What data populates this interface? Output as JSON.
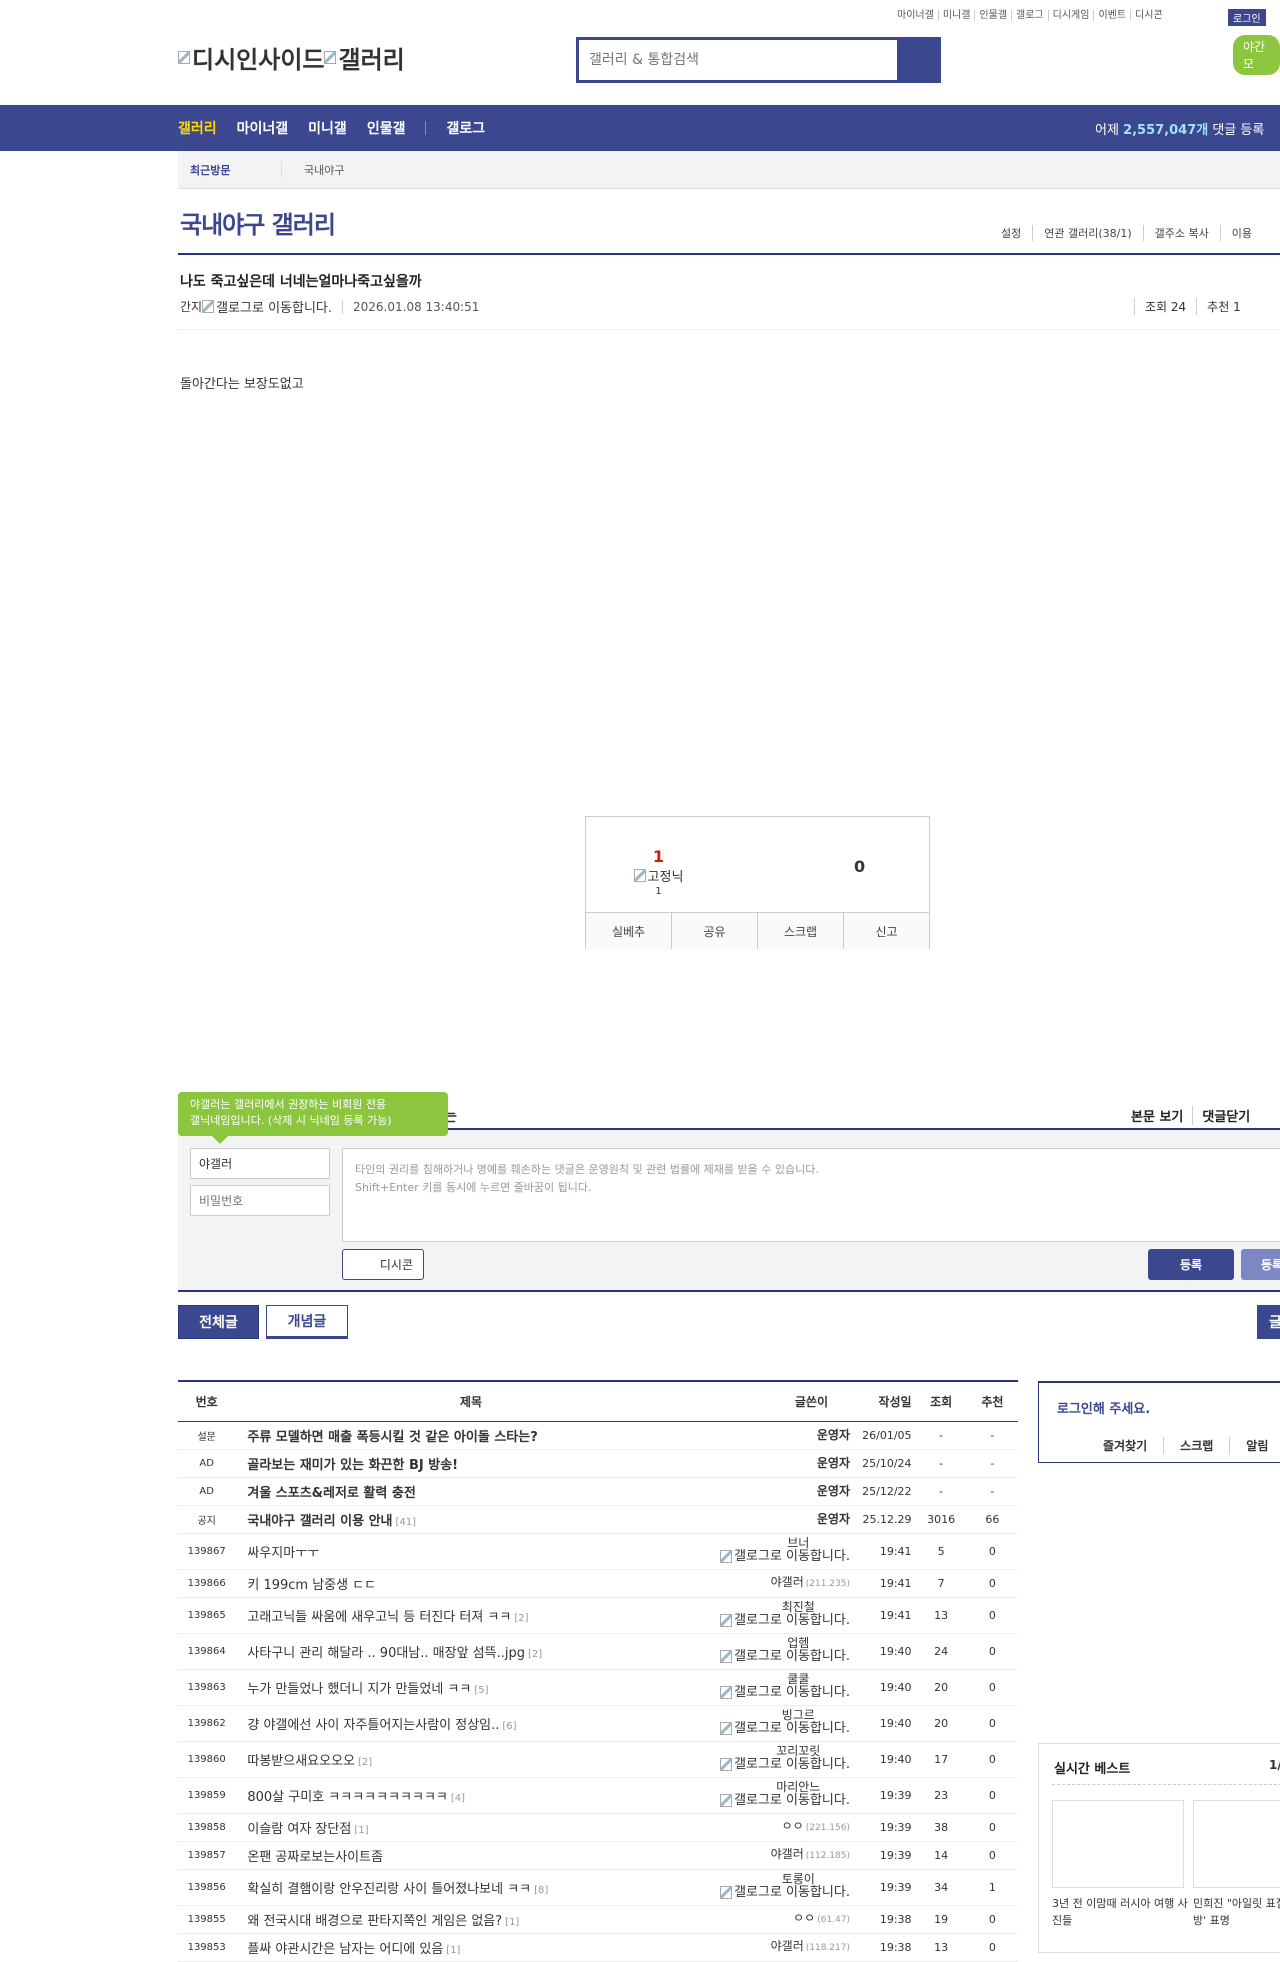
{
  "header": {
    "top_links": [
      "마이너갤",
      "미니갤",
      "인물갤",
      "갤로그",
      "디시게임",
      "이벤트",
      "디시콘"
    ],
    "login": "로그인",
    "night_mode": "야간 모",
    "logo_alt_1": "디시인사이드",
    "logo_alt_2": "갤러리",
    "search_placeholder": "갤러리 & 통합검색"
  },
  "nav": {
    "items": [
      "갤러리",
      "마이너갤",
      "미니갤",
      "인물갤"
    ],
    "gallog": "갤로그",
    "yesterday_prefix": "어제 ",
    "yesterday_count": "2,557,047개",
    "yesterday_suffix": " 댓글 등록"
  },
  "recent_visit": {
    "label": "최근방문",
    "item": "국내야구"
  },
  "gallery": {
    "title": "국내야구 갤러리",
    "menu": [
      "설정",
      "연관 갤러리(38/1)",
      "갤주소 복사",
      "이용"
    ]
  },
  "post": {
    "title": "나도 죽고싶은데 너네는얼마나죽고싶을까",
    "writer": "간지",
    "gallog_alt": "갤로그로 이동합니다.",
    "date": "2026.01.08 13:40:51",
    "views": "조회 24",
    "recommend": "추천 1",
    "body": "돌아간다는 보장도없고"
  },
  "recommend_box": {
    "up_count": "1",
    "fixed_alt": "고정닉",
    "fixed_count": "1",
    "down_count": "0",
    "buttons": [
      "실베추",
      "공유",
      "스크랩",
      "신고"
    ]
  },
  "comment": {
    "tooltip_line1": "야갤러는 갤러리에서 권장하는 비회원 전용",
    "tooltip_line2": "갤닉네임입니다. (삭제 시 닉네임 등록 가능)",
    "header_fragment": "는",
    "view_body": "본문 보기",
    "close_comments": "댓글닫기",
    "nick_value": "야갤러",
    "pw_placeholder": "비밀번호",
    "textarea_line1": "타인의 권리를 침해하거나 명예를 훼손하는 댓글은 운영원칙 및 관련 법률에 제재를 받을 수 있습니다.",
    "textarea_line2": "Shift+Enter 키를 동시에 누르면 줄바꿈이 됩니다.",
    "dccon": "디시콘",
    "register": "등록",
    "register2": "등록"
  },
  "tabs": {
    "all": "전체글",
    "recommended": "개념글",
    "right": "글"
  },
  "list": {
    "headers": [
      "번호",
      "제목",
      "글쓴이",
      "작성일",
      "조회",
      "추천"
    ],
    "rows": [
      {
        "num": "설문",
        "title": "주류 모델하면 매출 폭등시킬 것 같은 아이돌 스타는?",
        "bold": true,
        "reply": "",
        "writer": "운영자",
        "ip": "",
        "nb": "",
        "date": "26/01/05",
        "views": "-",
        "rec": "-"
      },
      {
        "num": "AD",
        "title": "골라보는 재미가 있는 화끈한 BJ 방송!",
        "bold": true,
        "reply": "",
        "writer": "운영자",
        "ip": "",
        "nb": "",
        "date": "25/10/24",
        "views": "-",
        "rec": "-"
      },
      {
        "num": "AD",
        "title": "겨울 스포츠&레저로 활력 충전",
        "bold": true,
        "reply": "",
        "writer": "운영자",
        "ip": "",
        "nb": "",
        "date": "25/12/22",
        "views": "-",
        "rec": "-"
      },
      {
        "num": "공지",
        "title": "국내야구 갤러리 이용 안내",
        "bold": true,
        "reply": "[41]",
        "writer": "운영자",
        "ip": "",
        "nb": "",
        "date": "25.12.29",
        "views": "3016",
        "rec": "66"
      },
      {
        "num": "139867",
        "title": "싸우지마ㅜㅜ",
        "bold": false,
        "reply": "",
        "writer": "",
        "ip": "",
        "nb": "브너",
        "date": "19:41",
        "views": "5",
        "rec": "0"
      },
      {
        "num": "139866",
        "title": "키 199cm 남중생 ㄷㄷ",
        "bold": false,
        "reply": "",
        "writer": "야갤러",
        "ip": "(211.235)",
        "nb": "",
        "date": "19:41",
        "views": "7",
        "rec": "0"
      },
      {
        "num": "139865",
        "title": "고래고닉들 싸움에 새우고닉 등 터진다 터져 ㅋㅋ",
        "bold": false,
        "reply": "[2]",
        "writer": "",
        "ip": "",
        "nb": "최진철",
        "date": "19:41",
        "views": "13",
        "rec": "0"
      },
      {
        "num": "139864",
        "title": "사타구니 관리 해달라 .. 90대남.. 매장앞 섬뜩..jpg",
        "bold": false,
        "reply": "[2]",
        "writer": "",
        "ip": "",
        "nb": "업헴",
        "date": "19:40",
        "views": "24",
        "rec": "0"
      },
      {
        "num": "139863",
        "title": "누가 만들었나 했더니 지가 만들었네 ㅋㅋ",
        "bold": false,
        "reply": "[5]",
        "writer": "",
        "ip": "",
        "nb": "쿨쿨",
        "date": "19:40",
        "views": "20",
        "rec": "0"
      },
      {
        "num": "139862",
        "title": "걍 야갤에선 사이 자주틀어지는사람이 정상임..",
        "bold": false,
        "reply": "[6]",
        "writer": "",
        "ip": "",
        "nb": "빙그르",
        "date": "19:40",
        "views": "20",
        "rec": "0"
      },
      {
        "num": "139860",
        "title": "따봉받으새요오오오",
        "bold": false,
        "reply": "[2]",
        "writer": "",
        "ip": "",
        "nb": "꼬리꼬릿",
        "date": "19:40",
        "views": "17",
        "rec": "0"
      },
      {
        "num": "139859",
        "title": "800살 구미호 ㅋㅋㅋㅋㅋㅋㅋㅋㅋㅋ",
        "bold": false,
        "reply": "[4]",
        "writer": "",
        "ip": "",
        "nb": "마리안느",
        "date": "19:39",
        "views": "23",
        "rec": "0"
      },
      {
        "num": "139858",
        "title": "이슬람 여자 장단점",
        "bold": false,
        "reply": "[1]",
        "writer": "ㅇㅇ",
        "ip": "(221.156)",
        "nb": "",
        "date": "19:39",
        "views": "38",
        "rec": "0"
      },
      {
        "num": "139857",
        "title": "온팬 공짜로보는사이트좀",
        "bold": false,
        "reply": "",
        "writer": "야갤러",
        "ip": "(112.185)",
        "nb": "",
        "date": "19:39",
        "views": "14",
        "rec": "0"
      },
      {
        "num": "139856",
        "title": "확실히 결햄이랑 안우진리랑 사이 틀어졌나보네 ㅋㅋ",
        "bold": false,
        "reply": "[8]",
        "writer": "",
        "ip": "",
        "nb": "토롱이",
        "date": "19:39",
        "views": "34",
        "rec": "1"
      },
      {
        "num": "139855",
        "title": "왜 전국시대 배경으로 판타지쪽인 게임은 없음?",
        "bold": false,
        "reply": "[1]",
        "writer": "ㅇㅇ",
        "ip": "(61.47)",
        "nb": "",
        "date": "19:38",
        "views": "19",
        "rec": "0"
      },
      {
        "num": "139853",
        "title": "플싸 야관시간은 남자는 어디에 있음",
        "bold": false,
        "reply": "[1]",
        "writer": "야갤러",
        "ip": "(118.217)",
        "nb": "",
        "date": "19:38",
        "views": "13",
        "rec": "0"
      }
    ]
  },
  "sidebar": {
    "login_title": "로그인해 주세요.",
    "login_links": [
      "즐겨찾기",
      "스크랩",
      "알림"
    ],
    "best_title": "실시간 베스트",
    "best_page": "1/",
    "best_caption1": "3년 전 이맘때 러시아 여행 사진들",
    "best_caption2": "민희진 \"아일릿 표절NO, '모방' 표명"
  }
}
